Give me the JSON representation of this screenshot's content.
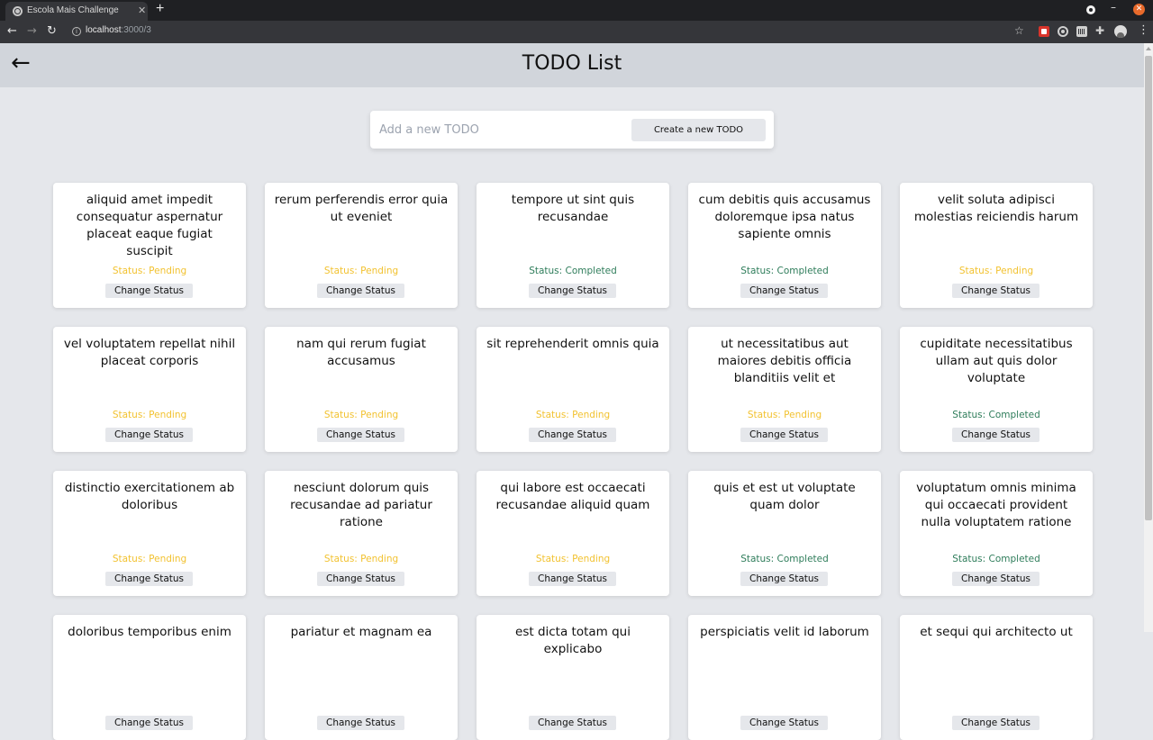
{
  "browser": {
    "tab_title": "Escola Mais Challenge",
    "tab_close": "✕",
    "new_tab": "+",
    "url_host": "localhost",
    "url_path": ":3000/3",
    "win_min": "–",
    "win_close": "✕",
    "nav_back": "←",
    "nav_forward": "→",
    "nav_reload": "↻",
    "info": "i",
    "star": "☆",
    "puzzle": "✚",
    "menu": "⋮"
  },
  "header": {
    "back_arrow": "←",
    "title": "TODO List"
  },
  "add_form": {
    "placeholder": "Add a new TODO",
    "button_label": "Create a new TODO"
  },
  "status_colors": {
    "pending": "#f2c230",
    "completed": "#2f7d5b"
  },
  "change_status_label": "Change Status",
  "todos": [
    {
      "title": "aliquid amet impedit consequatur aspernatur placeat eaque fugiat suscipit",
      "status": "Status: Pending",
      "state": "pending"
    },
    {
      "title": "rerum perferendis error quia ut eveniet",
      "status": "Status: Pending",
      "state": "pending"
    },
    {
      "title": "tempore ut sint quis recusandae",
      "status": "Status: Completed",
      "state": "completed"
    },
    {
      "title": "cum debitis quis accusamus doloremque ipsa natus sapiente omnis",
      "status": "Status: Completed",
      "state": "completed"
    },
    {
      "title": "velit soluta adipisci molestias reiciendis harum",
      "status": "Status: Pending",
      "state": "pending"
    },
    {
      "title": "vel voluptatem repellat nihil placeat corporis",
      "status": "Status: Pending",
      "state": "pending"
    },
    {
      "title": "nam qui rerum fugiat accusamus",
      "status": "Status: Pending",
      "state": "pending"
    },
    {
      "title": "sit reprehenderit omnis quia",
      "status": "Status: Pending",
      "state": "pending"
    },
    {
      "title": "ut necessitatibus aut maiores debitis officia blanditiis velit et",
      "status": "Status: Pending",
      "state": "pending"
    },
    {
      "title": "cupiditate necessitatibus ullam aut quis dolor voluptate",
      "status": "Status: Completed",
      "state": "completed"
    },
    {
      "title": "distinctio exercitationem ab doloribus",
      "status": "Status: Pending",
      "state": "pending"
    },
    {
      "title": "nesciunt dolorum quis recusandae ad pariatur ratione",
      "status": "Status: Pending",
      "state": "pending"
    },
    {
      "title": "qui labore est occaecati recusandae aliquid quam",
      "status": "Status: Pending",
      "state": "pending"
    },
    {
      "title": "quis et est ut voluptate quam dolor",
      "status": "Status: Completed",
      "state": "completed"
    },
    {
      "title": "voluptatum omnis minima qui occaecati provident nulla voluptatem ratione",
      "status": "Status: Completed",
      "state": "completed"
    },
    {
      "title": "doloribus temporibus enim",
      "status": "",
      "state": "pending"
    },
    {
      "title": "pariatur et magnam ea",
      "status": "",
      "state": "pending"
    },
    {
      "title": "est dicta totam qui explicabo",
      "status": "",
      "state": "pending"
    },
    {
      "title": "perspiciatis velit id laborum",
      "status": "",
      "state": "pending"
    },
    {
      "title": "et sequi qui architecto ut",
      "status": "",
      "state": "pending"
    }
  ]
}
